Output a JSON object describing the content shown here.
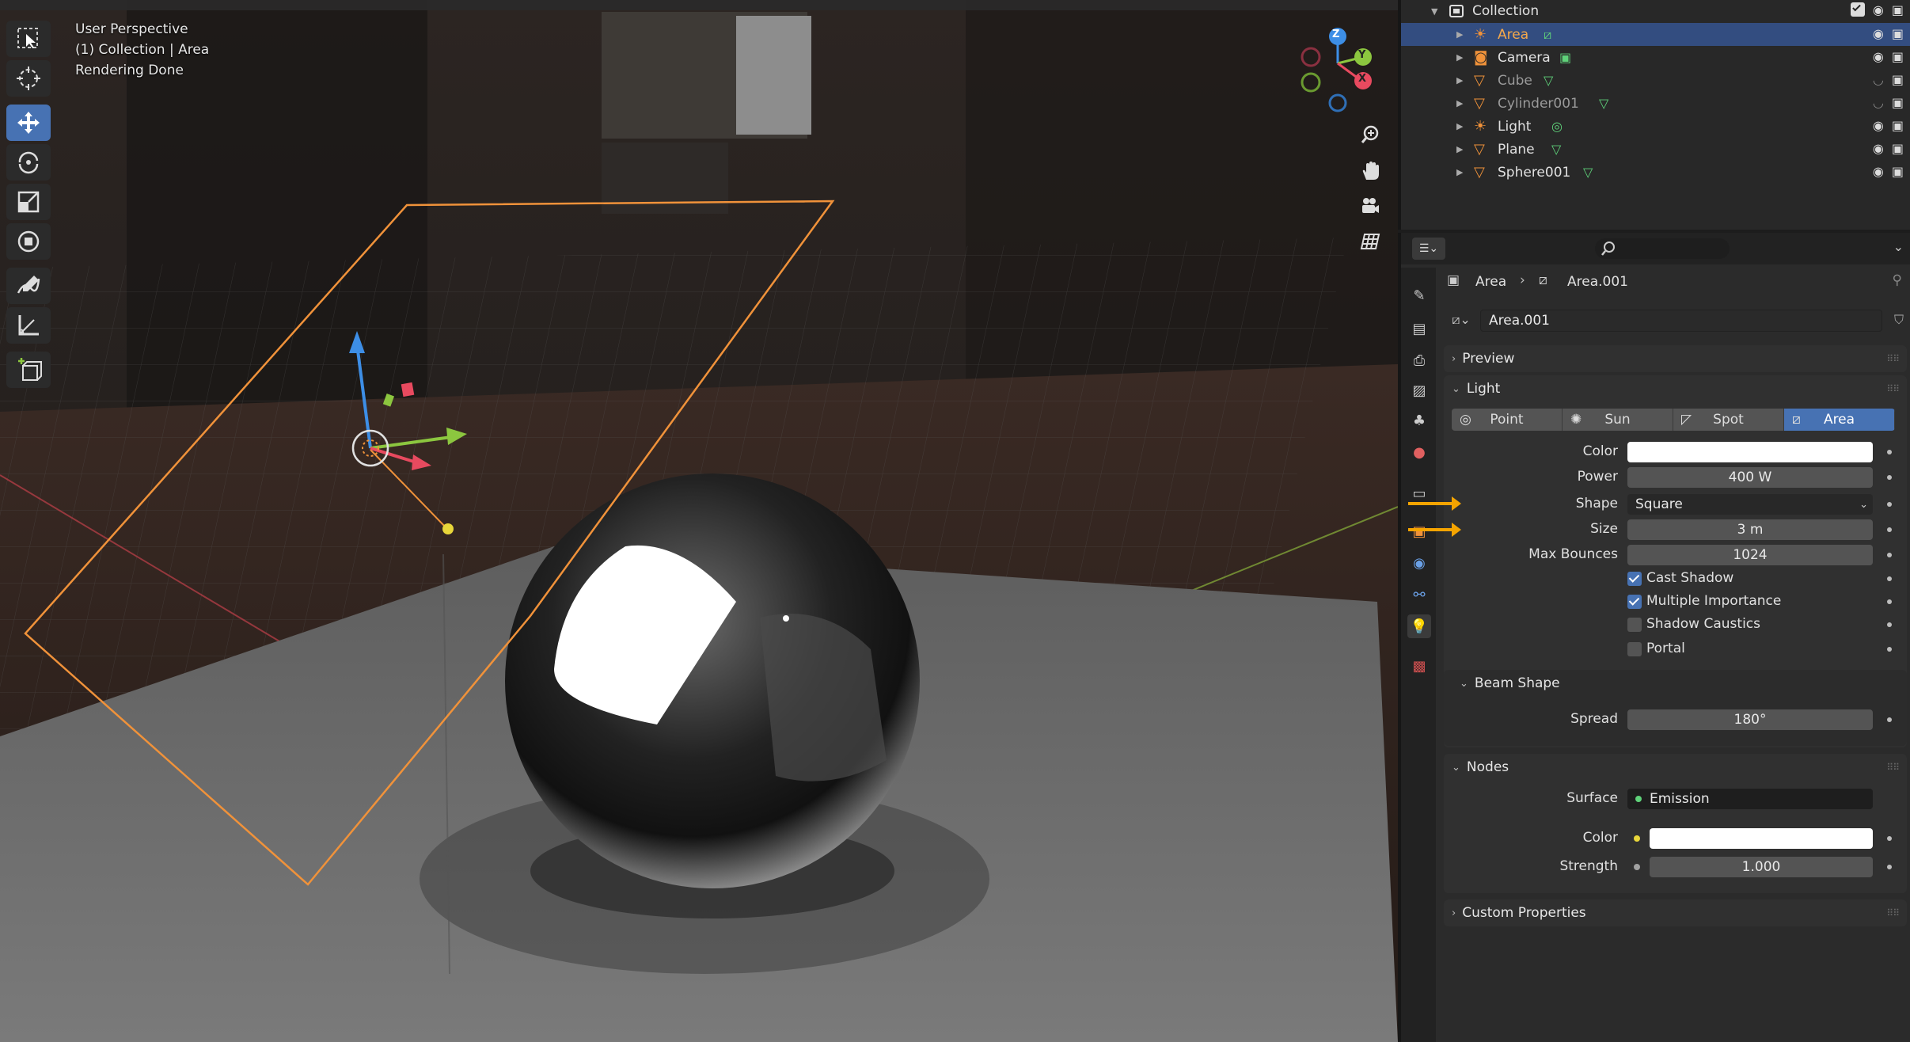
{
  "viewport": {
    "info_lines": [
      "User Perspective",
      "(1) Collection | Area",
      "Rendering Done"
    ],
    "tools": [
      "select-box",
      "cursor",
      "move",
      "rotate",
      "scale",
      "transform",
      "annotate",
      "measure",
      "add-cube"
    ],
    "active_tool": "move",
    "nav_buttons": [
      "zoom-icon",
      "hand-icon",
      "camera-icon",
      "grid-icon"
    ],
    "gizmo_axes": {
      "x": "X",
      "y": "Y",
      "z": "Z"
    },
    "colors": {
      "selection": "#f0923a",
      "x_axis": "#e84a5f",
      "y_axis": "#8cc63f",
      "z_axis": "#3d8ee6"
    }
  },
  "outliner": {
    "collection": "Collection",
    "items": [
      {
        "name": "Area",
        "type": "light-area",
        "selected": true,
        "dim": false
      },
      {
        "name": "Camera",
        "type": "camera",
        "selected": false,
        "dim": false
      },
      {
        "name": "Cube",
        "type": "mesh",
        "selected": false,
        "dim": true
      },
      {
        "name": "Cylinder001",
        "type": "mesh",
        "selected": false,
        "dim": true
      },
      {
        "name": "Light",
        "type": "light-point",
        "selected": false,
        "dim": false
      },
      {
        "name": "Plane",
        "type": "mesh",
        "selected": false,
        "dim": false
      },
      {
        "name": "Sphere001",
        "type": "mesh",
        "selected": false,
        "dim": false
      }
    ]
  },
  "properties": {
    "breadcrumb": {
      "object": "Area",
      "data": "Area.001"
    },
    "datablock": "Area.001",
    "panels": {
      "preview": "Preview",
      "light": "Light",
      "beam_shape": "Beam Shape",
      "nodes": "Nodes",
      "custom": "Custom Properties"
    },
    "light_types": [
      "Point",
      "Sun",
      "Spot",
      "Area"
    ],
    "active_light_type": "Area",
    "fields": {
      "color_label": "Color",
      "power_label": "Power",
      "power_value": "400 W",
      "shape_label": "Shape",
      "shape_value": "Square",
      "size_label": "Size",
      "size_value": "3 m",
      "bounces_label": "Max Bounces",
      "bounces_value": "1024",
      "cast_shadow": "Cast Shadow",
      "multiple_importance": "Multiple Importance",
      "shadow_caustics": "Shadow Caustics",
      "portal": "Portal",
      "spread_label": "Spread",
      "spread_value": "180°",
      "surface_label": "Surface",
      "surface_value": "Emission",
      "node_color_label": "Color",
      "strength_label": "Strength",
      "strength_value": "1.000"
    },
    "checks": {
      "cast_shadow": true,
      "multiple_importance": true,
      "shadow_caustics": false,
      "portal": false
    },
    "accent": "#4772b3",
    "annotation_arrow_color": "#f5a400"
  }
}
